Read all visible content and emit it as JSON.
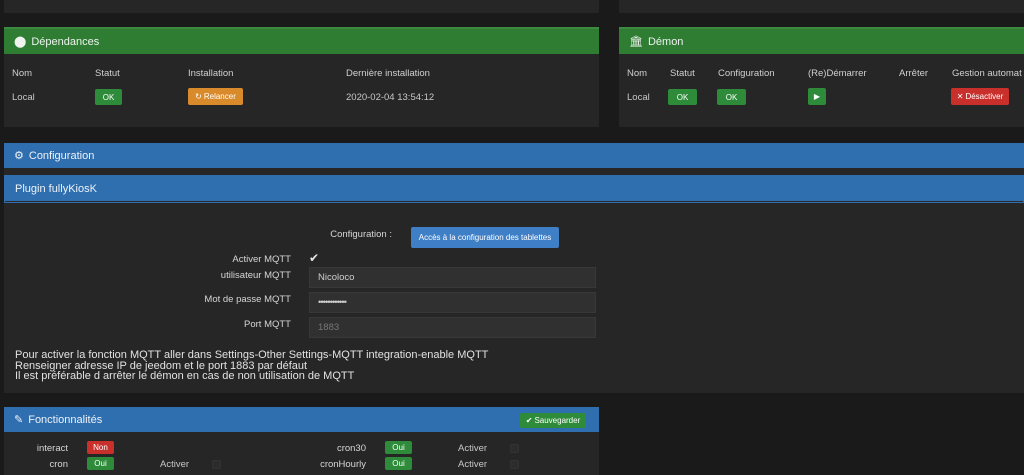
{
  "dependances": {
    "title": "Dépendances",
    "headers": [
      "Nom",
      "Statut",
      "Installation",
      "Dernière installation"
    ],
    "row": {
      "nom": "Local",
      "statut": "OK",
      "installation": "Relancer",
      "derniere": "2020-02-04 13:54:12"
    }
  },
  "demon": {
    "title": "Démon",
    "headers": [
      "Nom",
      "Statut",
      "Configuration",
      "(Re)Démarrer",
      "Arrêter",
      "Gestion automat"
    ],
    "row": {
      "nom": "Local",
      "statut": "OK",
      "configuration": "OK",
      "desactiver": "Désactiver"
    }
  },
  "configuration": {
    "title": "Configuration",
    "plugin_title": "Plugin fullyKiosK",
    "config_label": "Configuration :",
    "config_button": "Accès à la configuration des tablettes",
    "fields": {
      "activer_mqtt": "Activer MQTT",
      "utilisateur_mqtt": "utilisateur MQTT",
      "utilisateur_value": "Nicoloco",
      "password_label": "Mot de passe MQTT",
      "password_value": "••••••••••••",
      "port_label": "Port MQTT",
      "port_placeholder": "1883"
    },
    "info": [
      "Pour activer la fonction MQTT aller dans Settings-Other Settings-MQTT integration-enable MQTT",
      "Renseigner adresse IP de jeedom et le port 1883 par défaut",
      "Il est préférable d arrêter le démon en cas de non utilisation de MQTT"
    ]
  },
  "fonctionnalites": {
    "title": "Fonctionnalités",
    "save": "Sauvegarder",
    "rows": [
      {
        "name": "interact",
        "value": "Non"
      },
      {
        "name": "cron",
        "value": "Oui",
        "activer": "Activer"
      },
      {
        "name": "cron30",
        "value": "Oui",
        "activer": "Activer"
      },
      {
        "name": "cronHourly",
        "value": "Oui",
        "activer": "Activer"
      }
    ]
  },
  "colors": {
    "green": "#2e7d32",
    "blue": "#2f6fb0",
    "ok": "#2e8b3a",
    "orange": "#d98a2b",
    "red": "#c9302c"
  }
}
